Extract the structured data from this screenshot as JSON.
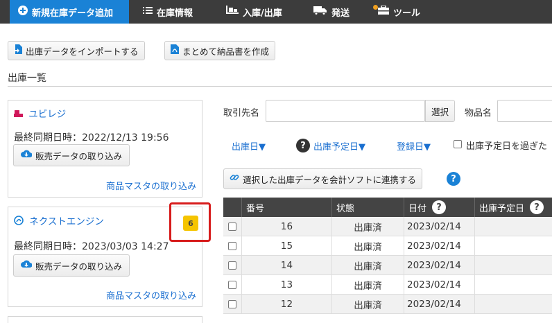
{
  "nav": {
    "items": [
      {
        "icon": "plus-circle",
        "label": "新規在庫データ追加",
        "active": true
      },
      {
        "icon": "list",
        "label": "在庫情報"
      },
      {
        "icon": "dolly",
        "label": "入庫/出庫"
      },
      {
        "icon": "truck",
        "label": "発送"
      },
      {
        "icon": "toolbox",
        "label": "ツール"
      }
    ]
  },
  "toolbar": {
    "import_label": "出庫データをインポートする",
    "invoice_label": "まとめて納品書を作成"
  },
  "section_title": "出庫一覧",
  "shops": [
    {
      "name": "ユビレジ",
      "sync": "最終同期日時：2022/12/13 19:56",
      "import_button": "販売データの取り込み",
      "master_link": "商品マスタの取り込み"
    },
    {
      "name": "ネクストエンジン",
      "badge": "6",
      "sync": "最終同期日時：2023/03/03 14:27",
      "import_button": "販売データの取り込み",
      "master_link": "商品マスタの取り込み"
    }
  ],
  "filters": {
    "partner_label": "取引先名",
    "select_label": "選択",
    "item_label": "物品名",
    "sort_ship": "出庫日▼",
    "sort_planned": "出庫予定日▼",
    "sort_registered": "登録日▼",
    "overdue_label": "出庫予定日を過ぎた"
  },
  "sync_button_label": "選択した出庫データを会計ソフトに連携する",
  "table": {
    "headers": [
      "番号",
      "状態",
      "日付",
      "出庫予定日"
    ],
    "rows": [
      {
        "no": "16",
        "status": "出庫済",
        "date": "2023/02/14"
      },
      {
        "no": "15",
        "status": "出庫済",
        "date": "2023/02/14"
      },
      {
        "no": "14",
        "status": "出庫済",
        "date": "2023/02/14"
      },
      {
        "no": "13",
        "status": "出庫済",
        "date": "2023/02/14"
      },
      {
        "no": "12",
        "status": "出庫済",
        "date": "2023/02/14"
      }
    ]
  },
  "colors": {
    "nav_bg": "#3c3c3c",
    "accent": "#1a82d6",
    "badge": "#f5c400",
    "highlight": "#d71c1c"
  }
}
